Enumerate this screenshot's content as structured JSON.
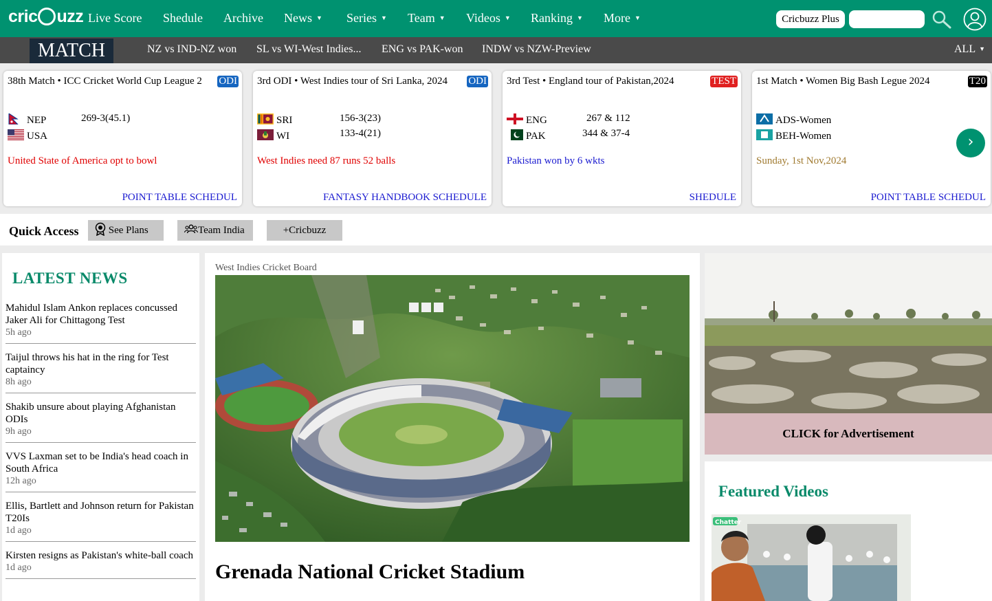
{
  "brand": {
    "logo_text": "cricbuzz"
  },
  "nav": {
    "items": [
      {
        "label": "Live Score",
        "caret": false
      },
      {
        "label": "Shedule",
        "caret": false
      },
      {
        "label": "Archive",
        "caret": false
      },
      {
        "label": "News",
        "caret": true
      },
      {
        "label": "Series",
        "caret": true
      },
      {
        "label": "Team",
        "caret": true
      },
      {
        "label": "Videos",
        "caret": true
      },
      {
        "label": "Ranking",
        "caret": true
      },
      {
        "label": "More",
        "caret": true
      }
    ],
    "plus_label": "Cricbuzz Plus",
    "search_placeholder": "",
    "search_value": ""
  },
  "matchbar": {
    "label": "MATCH",
    "links": [
      "NZ vs IND-NZ won",
      "SL vs WI-West Indies...",
      "ENG vs PAK-won",
      "INDW vs NZW-Preview"
    ],
    "all_label": "ALL"
  },
  "cards": [
    {
      "title": "38th Match • ICC Cricket World Cup League 2",
      "format": "ODI",
      "teams": [
        {
          "name": "NEP",
          "score": "269-3(45.1)"
        },
        {
          "name": "USA",
          "score": ""
        }
      ],
      "status": "United State of America opt to bowl",
      "status_color": "#e00000",
      "links": [
        "POINT TABLE",
        "SCHEDUL"
      ]
    },
    {
      "title": "3rd ODI • West Indies tour of Sri Lanka, 2024",
      "format": "ODI",
      "teams": [
        {
          "name": "SRI",
          "score": "156-3(23)"
        },
        {
          "name": "WI",
          "score": "133-4(21)"
        }
      ],
      "status": "West Indies need 87 runs 52 balls",
      "status_color": "#e00000",
      "links": [
        "FANTASY HANDBOOK",
        "SCHEDULE"
      ]
    },
    {
      "title": "3rd Test • England tour of Pakistan,2024",
      "format": "TEST",
      "teams": [
        {
          "name": "ENG",
          "score": "267 & 112"
        },
        {
          "name": "PAK",
          "score": "344 & 37-4"
        }
      ],
      "status": "Pakistan won by 6 wkts",
      "status_color": "#1a1ad0",
      "links": [
        "SHEDULE"
      ]
    },
    {
      "title": "1st Match • Women Big Bash Legue 2024",
      "format": "T20",
      "teams": [
        {
          "name": "ADS-Women",
          "score": ""
        },
        {
          "name": "BEH-Women",
          "score": ""
        }
      ],
      "status": "Sunday, 1st Nov,2024",
      "status_color": "#a07a30",
      "links": [
        "POINT TABLE",
        "SCHEDUL"
      ]
    }
  ],
  "quick_access": {
    "label": "Quick Access",
    "buttons": [
      "See Plans",
      "Team India",
      "+Cricbuzz"
    ]
  },
  "latest_news": {
    "title": "LATEST NEWS",
    "items": [
      {
        "headline": "Mahidul Islam Ankon replaces concussed Jaker Ali for Chittagong Test",
        "time": "5h ago"
      },
      {
        "headline": "Taijul throws his hat in the ring for Test captaincy",
        "time": "8h ago"
      },
      {
        "headline": "Shakib unsure about playing Afghanistan ODIs",
        "time": "9h ago"
      },
      {
        "headline": "VVS Laxman set to be India's head coach in South Africa",
        "time": "12h ago"
      },
      {
        "headline": "Ellis, Bartlett and Johnson return for Pakistan T20Is",
        "time": "1d ago"
      },
      {
        "headline": "Kirsten resigns as Pakistan's white-ball coach",
        "time": "1d ago"
      }
    ]
  },
  "feature": {
    "image_credit": "West Indies Cricket Board",
    "headline": "Grenada National Cricket Stadium"
  },
  "ad": {
    "label": "CLICK for Advertisement"
  },
  "featured_videos": {
    "title": "Featured Videos",
    "thumb_tag": "Chatter"
  },
  "colors": {
    "brand_green": "#009270",
    "matchbar": "#4a4a4a",
    "news_title": "#0a8a6a"
  }
}
